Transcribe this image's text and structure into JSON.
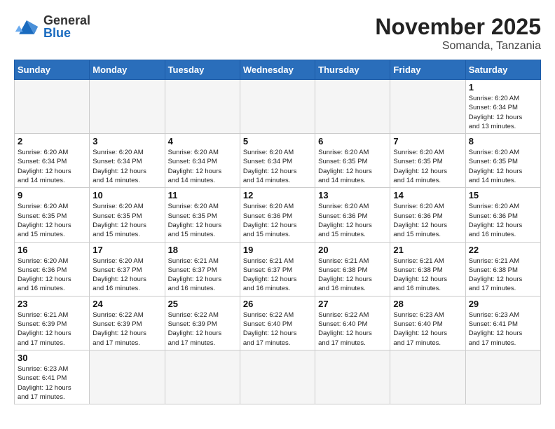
{
  "logo": {
    "general": "General",
    "blue": "Blue"
  },
  "title": {
    "month_year": "November 2025",
    "location": "Somanda, Tanzania"
  },
  "weekdays": [
    "Sunday",
    "Monday",
    "Tuesday",
    "Wednesday",
    "Thursday",
    "Friday",
    "Saturday"
  ],
  "weeks": [
    [
      {
        "day": "",
        "info": ""
      },
      {
        "day": "",
        "info": ""
      },
      {
        "day": "",
        "info": ""
      },
      {
        "day": "",
        "info": ""
      },
      {
        "day": "",
        "info": ""
      },
      {
        "day": "",
        "info": ""
      },
      {
        "day": "1",
        "info": "Sunrise: 6:20 AM\nSunset: 6:34 PM\nDaylight: 12 hours\nand 13 minutes."
      }
    ],
    [
      {
        "day": "2",
        "info": "Sunrise: 6:20 AM\nSunset: 6:34 PM\nDaylight: 12 hours\nand 14 minutes."
      },
      {
        "day": "3",
        "info": "Sunrise: 6:20 AM\nSunset: 6:34 PM\nDaylight: 12 hours\nand 14 minutes."
      },
      {
        "day": "4",
        "info": "Sunrise: 6:20 AM\nSunset: 6:34 PM\nDaylight: 12 hours\nand 14 minutes."
      },
      {
        "day": "5",
        "info": "Sunrise: 6:20 AM\nSunset: 6:34 PM\nDaylight: 12 hours\nand 14 minutes."
      },
      {
        "day": "6",
        "info": "Sunrise: 6:20 AM\nSunset: 6:35 PM\nDaylight: 12 hours\nand 14 minutes."
      },
      {
        "day": "7",
        "info": "Sunrise: 6:20 AM\nSunset: 6:35 PM\nDaylight: 12 hours\nand 14 minutes."
      },
      {
        "day": "8",
        "info": "Sunrise: 6:20 AM\nSunset: 6:35 PM\nDaylight: 12 hours\nand 14 minutes."
      }
    ],
    [
      {
        "day": "9",
        "info": "Sunrise: 6:20 AM\nSunset: 6:35 PM\nDaylight: 12 hours\nand 15 minutes."
      },
      {
        "day": "10",
        "info": "Sunrise: 6:20 AM\nSunset: 6:35 PM\nDaylight: 12 hours\nand 15 minutes."
      },
      {
        "day": "11",
        "info": "Sunrise: 6:20 AM\nSunset: 6:35 PM\nDaylight: 12 hours\nand 15 minutes."
      },
      {
        "day": "12",
        "info": "Sunrise: 6:20 AM\nSunset: 6:36 PM\nDaylight: 12 hours\nand 15 minutes."
      },
      {
        "day": "13",
        "info": "Sunrise: 6:20 AM\nSunset: 6:36 PM\nDaylight: 12 hours\nand 15 minutes."
      },
      {
        "day": "14",
        "info": "Sunrise: 6:20 AM\nSunset: 6:36 PM\nDaylight: 12 hours\nand 15 minutes."
      },
      {
        "day": "15",
        "info": "Sunrise: 6:20 AM\nSunset: 6:36 PM\nDaylight: 12 hours\nand 16 minutes."
      }
    ],
    [
      {
        "day": "16",
        "info": "Sunrise: 6:20 AM\nSunset: 6:36 PM\nDaylight: 12 hours\nand 16 minutes."
      },
      {
        "day": "17",
        "info": "Sunrise: 6:20 AM\nSunset: 6:37 PM\nDaylight: 12 hours\nand 16 minutes."
      },
      {
        "day": "18",
        "info": "Sunrise: 6:21 AM\nSunset: 6:37 PM\nDaylight: 12 hours\nand 16 minutes."
      },
      {
        "day": "19",
        "info": "Sunrise: 6:21 AM\nSunset: 6:37 PM\nDaylight: 12 hours\nand 16 minutes."
      },
      {
        "day": "20",
        "info": "Sunrise: 6:21 AM\nSunset: 6:38 PM\nDaylight: 12 hours\nand 16 minutes."
      },
      {
        "day": "21",
        "info": "Sunrise: 6:21 AM\nSunset: 6:38 PM\nDaylight: 12 hours\nand 16 minutes."
      },
      {
        "day": "22",
        "info": "Sunrise: 6:21 AM\nSunset: 6:38 PM\nDaylight: 12 hours\nand 17 minutes."
      }
    ],
    [
      {
        "day": "23",
        "info": "Sunrise: 6:21 AM\nSunset: 6:39 PM\nDaylight: 12 hours\nand 17 minutes."
      },
      {
        "day": "24",
        "info": "Sunrise: 6:22 AM\nSunset: 6:39 PM\nDaylight: 12 hours\nand 17 minutes."
      },
      {
        "day": "25",
        "info": "Sunrise: 6:22 AM\nSunset: 6:39 PM\nDaylight: 12 hours\nand 17 minutes."
      },
      {
        "day": "26",
        "info": "Sunrise: 6:22 AM\nSunset: 6:40 PM\nDaylight: 12 hours\nand 17 minutes."
      },
      {
        "day": "27",
        "info": "Sunrise: 6:22 AM\nSunset: 6:40 PM\nDaylight: 12 hours\nand 17 minutes."
      },
      {
        "day": "28",
        "info": "Sunrise: 6:23 AM\nSunset: 6:40 PM\nDaylight: 12 hours\nand 17 minutes."
      },
      {
        "day": "29",
        "info": "Sunrise: 6:23 AM\nSunset: 6:41 PM\nDaylight: 12 hours\nand 17 minutes."
      }
    ],
    [
      {
        "day": "30",
        "info": "Sunrise: 6:23 AM\nSunset: 6:41 PM\nDaylight: 12 hours\nand 17 minutes."
      },
      {
        "day": "",
        "info": ""
      },
      {
        "day": "",
        "info": ""
      },
      {
        "day": "",
        "info": ""
      },
      {
        "day": "",
        "info": ""
      },
      {
        "day": "",
        "info": ""
      },
      {
        "day": "",
        "info": ""
      }
    ]
  ]
}
